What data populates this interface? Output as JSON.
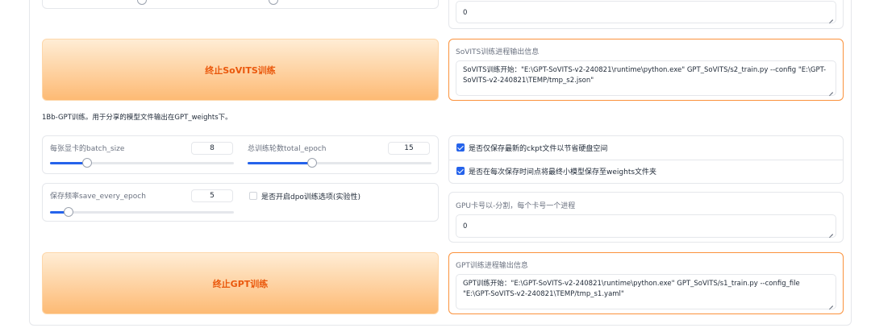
{
  "top": {
    "partial_box_value": "0"
  },
  "sovits": {
    "stop_button_label": "终止SoVITS训练",
    "output_label": "SoVITS训练进程输出信息",
    "output_text": "SoVITS训练开始：\"E:\\GPT-SoVITS-v2-240821\\runtime\\python.exe\" GPT_SoVITS/s2_train.py --config \"E:\\GPT-SoVITS-v2-240821\\TEMP/tmp_s2.json\""
  },
  "gpt_section": {
    "heading": "1Bb-GPT训练。用于分享的模型文件输出在GPT_weights下。",
    "batch_size": {
      "label": "每张显卡的batch_size",
      "value": "8",
      "fraction": 0.2
    },
    "total_epoch": {
      "label": "总训练轮数total_epoch",
      "value": "15",
      "fraction": 0.35
    },
    "save_every_epoch": {
      "label": "保存频率save_every_epoch",
      "value": "5",
      "fraction": 0.1
    },
    "dpo_checkbox": {
      "label": "是否开启dpo训练选项(实验性)",
      "checked": false
    },
    "save_latest_checkbox": {
      "label": "是否仅保存最新的ckpt文件以节省硬盘空间",
      "checked": true
    },
    "save_weights_checkbox": {
      "label": "是否在每次保存时间点将最终小模型保存至weights文件夹",
      "checked": true
    },
    "gpu_label": "GPU卡号以-分割，每个卡号一个进程",
    "gpu_value": "0",
    "stop_button_label": "终止GPT训练",
    "output_label": "GPT训练进程输出信息",
    "output_text": "GPT训练开始：\"E:\\GPT-SoVITS-v2-240821\\runtime\\python.exe\" GPT_SoVITS/s1_train.py --config_file \"E:\\GPT-SoVITS-v2-240821\\TEMP/tmp_s1.yaml\""
  },
  "colors": {
    "accent": "#2563eb",
    "button_text": "#ea580c",
    "focus_border": "#fb923c"
  }
}
